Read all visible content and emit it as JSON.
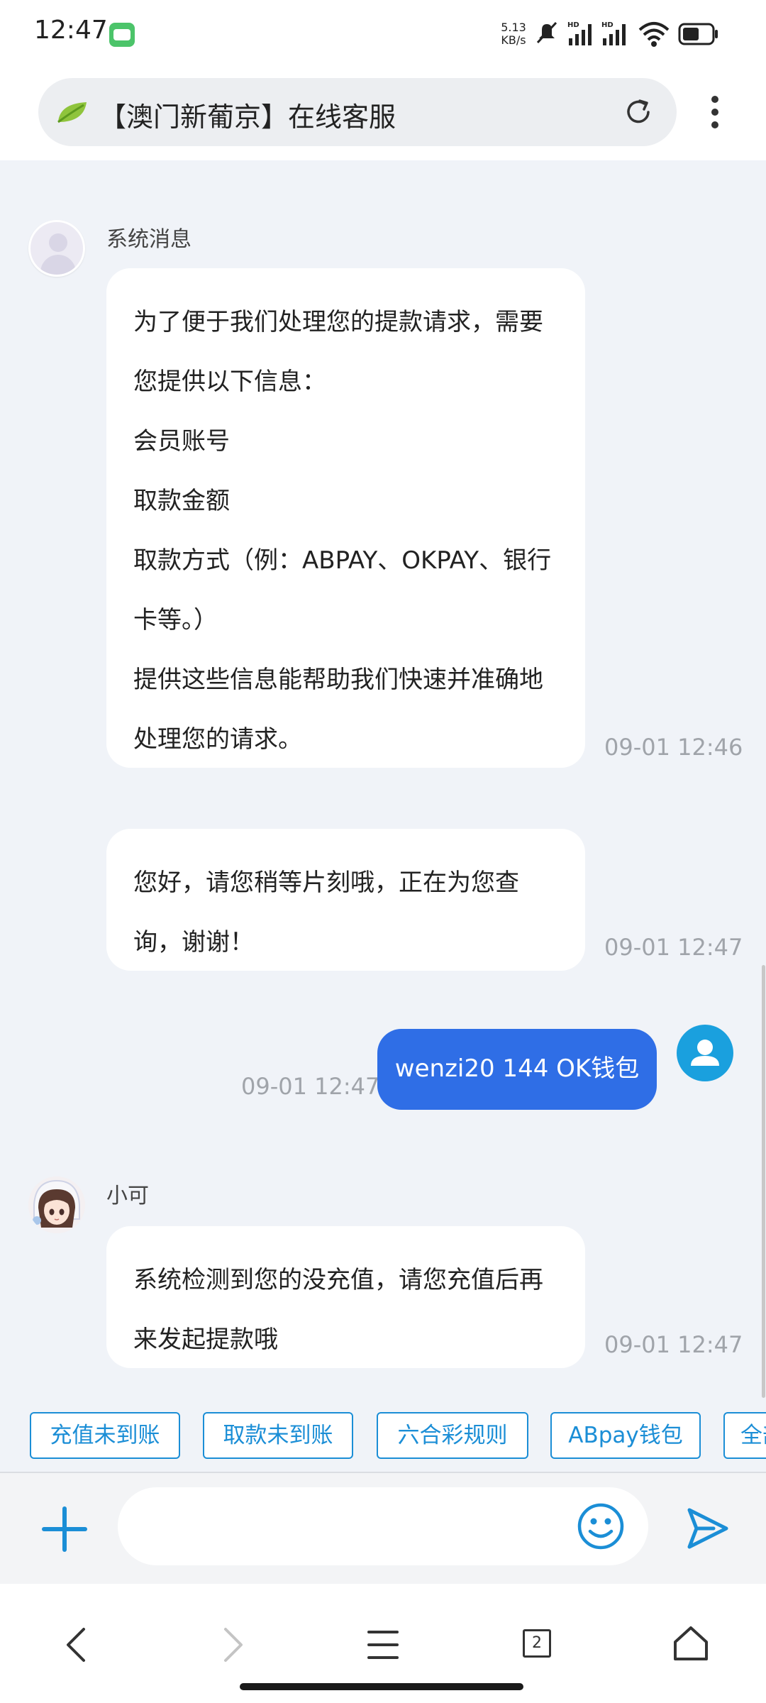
{
  "status_bar": {
    "time": "12:47",
    "net_speed_value": "5.13",
    "net_speed_unit": "KB/s",
    "icons": [
      "app-notification-icon",
      "mute-icon",
      "signal-hd-icon",
      "signal-hd-icon",
      "wifi-icon",
      "battery-icon"
    ]
  },
  "browser": {
    "page_title": "【澳门新葡京】在线客服",
    "tabs_count": "2"
  },
  "messages": [
    {
      "sender": "系统消息",
      "lines": [
        "为了便于我们处理您的提款请求，需要",
        "您提供以下信息：",
        "会员账号",
        "取款金额",
        "取款方式（例：ABPAY、OKPAY、银行",
        "卡等。）",
        "提供这些信息能帮助我们快速并准确地",
        "处理您的请求。"
      ],
      "time": "09-01 12:46"
    },
    {
      "lines": [
        "您好，请您稍等片刻哦，正在为您查",
        "询，谢谢！"
      ],
      "time": "09-01 12:47"
    },
    {
      "outgoing": true,
      "text": "wenzi20 144 OK钱包",
      "time": "09-01 12:47"
    },
    {
      "sender": "小可",
      "lines": [
        "系统检测到您的没充值，请您充值后再",
        "来发起提款哦"
      ],
      "time": "09-01 12:47"
    }
  ],
  "quick_replies": [
    "充值未到账",
    "取款未到账",
    "六合彩规则",
    "ABpay钱包",
    "全部"
  ],
  "colors": {
    "accent": "#2f6ee6",
    "chip": "#1b8ed6",
    "chat_bg": "#f0f3f8"
  }
}
